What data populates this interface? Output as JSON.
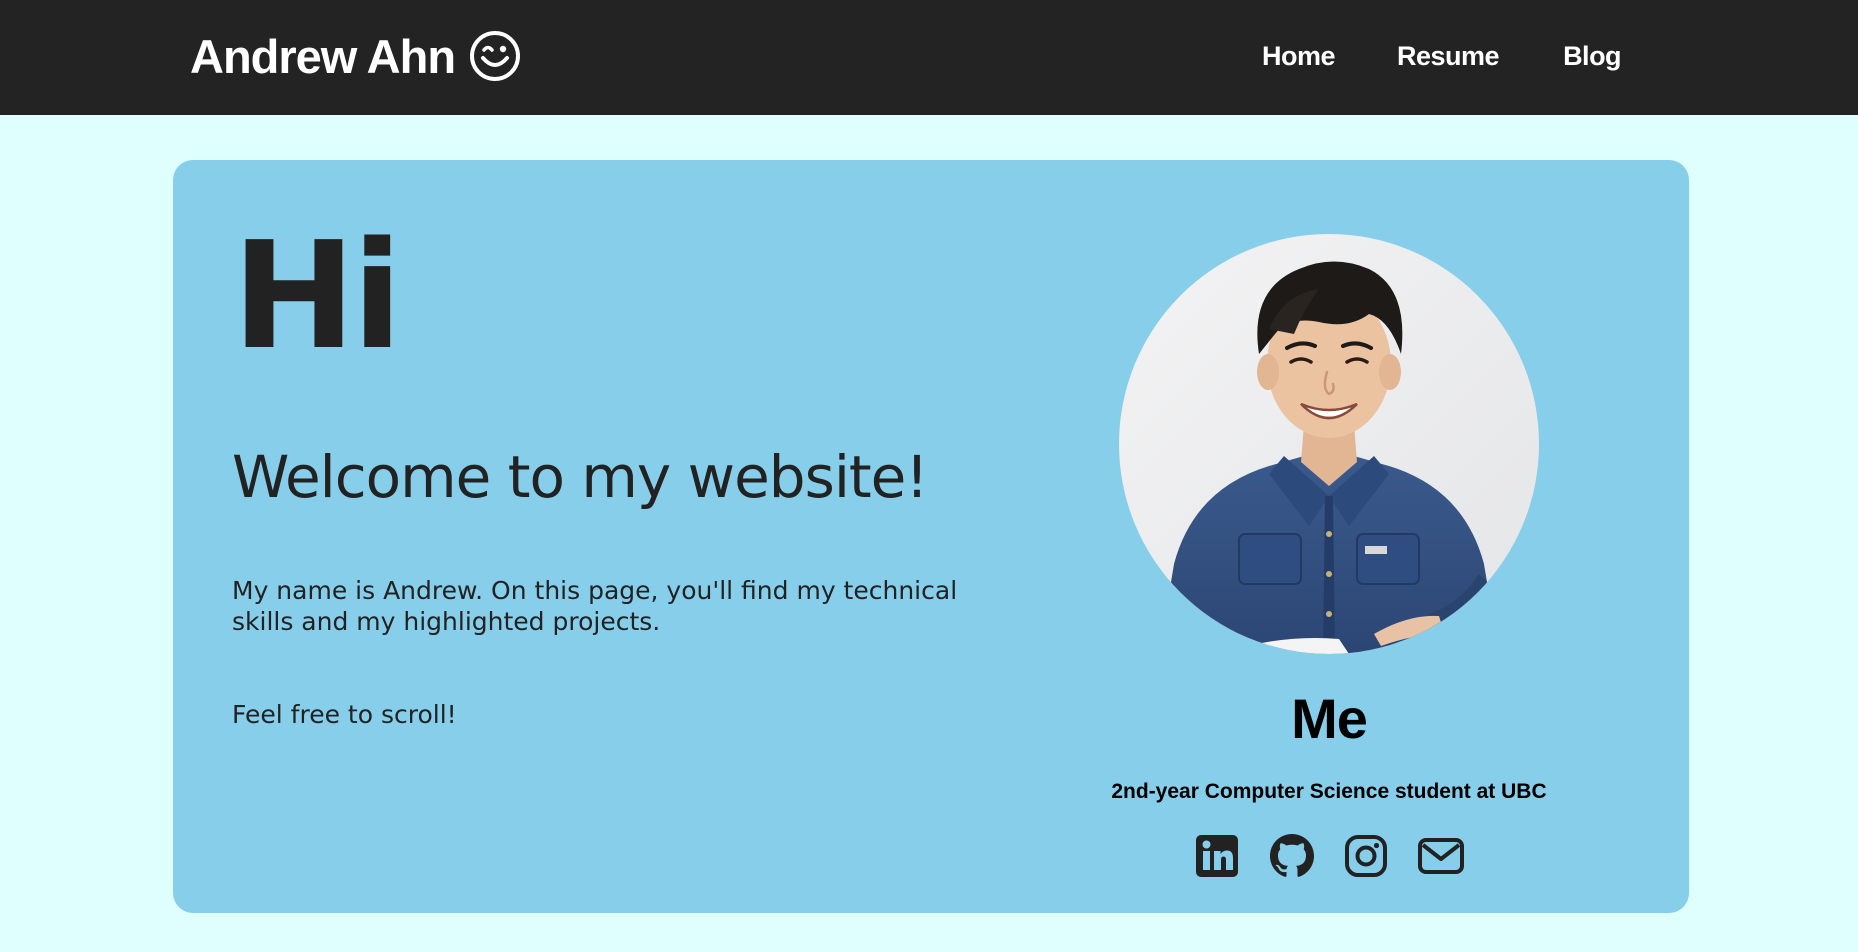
{
  "nav": {
    "brand": "Andrew Ahn",
    "brand_icon": "wink-smiley-icon",
    "links": [
      {
        "label": "Home"
      },
      {
        "label": "Resume"
      },
      {
        "label": "Blog"
      }
    ]
  },
  "hero": {
    "greeting": "Hi",
    "welcome": "Welcome to my website!",
    "intro": "My name is Andrew. On this page, you'll find my technical skills and my highlighted projects.",
    "scroll_note": "Feel free to scroll!"
  },
  "profile": {
    "name": "Me",
    "role": "2nd-year Computer Science student at UBC",
    "photo_alt": "profile-photo",
    "socials": [
      {
        "icon": "linkedin-icon"
      },
      {
        "icon": "github-icon"
      },
      {
        "icon": "instagram-icon"
      },
      {
        "icon": "email-icon"
      }
    ]
  },
  "colors": {
    "navbar_bg": "#232323",
    "page_bg": "#dffffe",
    "card_bg": "#87ceeb",
    "text": "#222222"
  }
}
